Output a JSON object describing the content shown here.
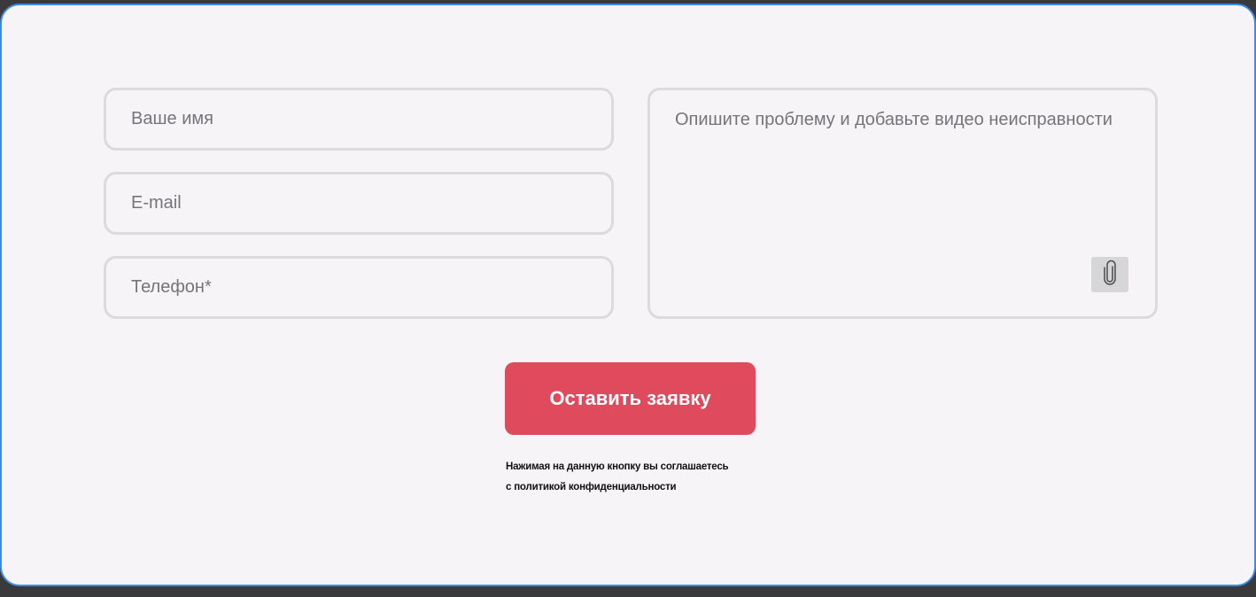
{
  "form": {
    "name_placeholder": "Ваше имя",
    "email_placeholder": "E-mail",
    "phone_placeholder": "Телефон*",
    "message_placeholder": "Опишите проблему и добавьте видео неисправности",
    "attach_icon": "paperclip-icon",
    "submit_label": "Оставить заявку",
    "consent_line1": "Нажимая на данную кнопку вы соглашаетесь",
    "consent_line2": "с политикой конфиденциальности"
  },
  "colors": {
    "accent": "#df4a5d",
    "card_border": "#3b8be8",
    "card_background": "#f6f4f6",
    "field_border": "#dcdadc"
  }
}
